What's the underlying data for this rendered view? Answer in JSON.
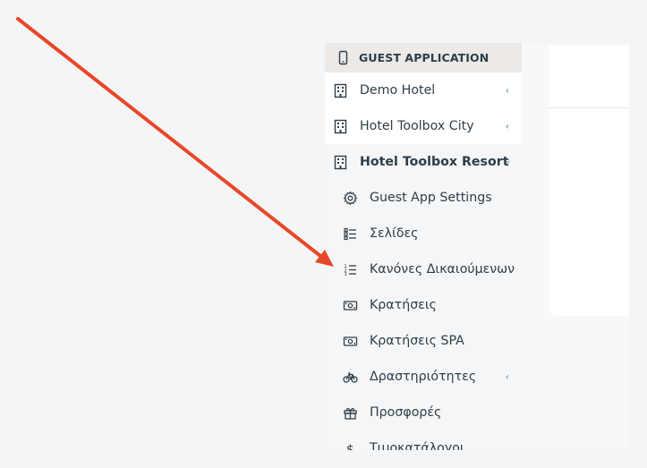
{
  "sidebar": {
    "section_header": "GUEST APPLICATION",
    "hotels": [
      {
        "label": "Demo Hotel",
        "expanded": false
      },
      {
        "label": "Hotel Toolbox City",
        "expanded": false
      },
      {
        "label": "Hotel Toolbox Resort",
        "expanded": true
      }
    ],
    "resort_items": [
      {
        "label": "Guest App Settings",
        "icon": "gear-icon"
      },
      {
        "label": "Σελίδες",
        "icon": "list-icon"
      },
      {
        "label": "Κανόνες Δικαιούμενων",
        "icon": "ordered-list-icon"
      },
      {
        "label": "Κρατήσεις",
        "icon": "money-bill-icon"
      },
      {
        "label": "Κρατήσεις SPA",
        "icon": "money-bill-icon"
      },
      {
        "label": "Δραστηριότητες",
        "icon": "bicycle-icon",
        "has_children": true
      },
      {
        "label": "Προσφορές",
        "icon": "gift-icon"
      },
      {
        "label": "Τιμοκατάλογοι",
        "icon": "dollar-icon"
      }
    ]
  },
  "annotation": {
    "arrow_color": "#e8472a"
  },
  "colors": {
    "text": "#2d3e4a",
    "chevron": "#5a8aa8",
    "header_bg": "#ece9e6"
  }
}
